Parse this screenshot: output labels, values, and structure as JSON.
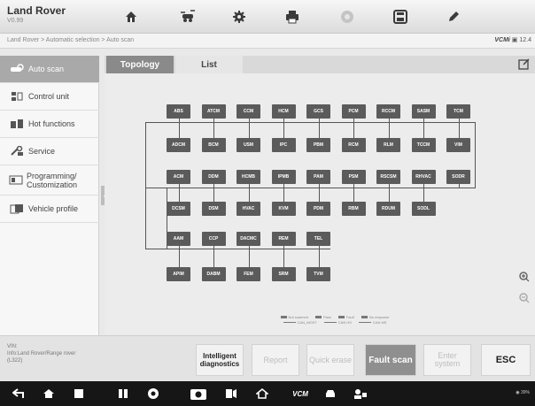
{
  "app": {
    "name": "Land Rover",
    "version": "V0.99"
  },
  "toolbar": {
    "items": [
      {
        "icon": "home-icon"
      },
      {
        "icon": "vehicle-swap-icon"
      },
      {
        "icon": "settings-icon"
      },
      {
        "icon": "print-icon"
      },
      {
        "icon": "help-icon"
      },
      {
        "icon": "save-icon"
      },
      {
        "icon": "edit-icon"
      }
    ]
  },
  "breadcrumb": "Land Rover > Automatic selection > Auto scan",
  "status": {
    "vcm_label": "VCMi",
    "vcm_value": "12.4"
  },
  "sidebar": {
    "items": [
      {
        "label": "Auto scan",
        "icon": "auto-scan-icon",
        "active": true
      },
      {
        "label": "Control unit",
        "icon": "control-unit-icon"
      },
      {
        "label": "Hot functions",
        "icon": "hot-functions-icon"
      },
      {
        "label": "Service",
        "icon": "service-icon"
      },
      {
        "label": "Programming/ Customization",
        "icon": "programming-icon"
      },
      {
        "label": "Vehicle profile",
        "icon": "vehicle-profile-icon"
      }
    ]
  },
  "tabs": [
    {
      "label": "Topology"
    },
    {
      "label": "List"
    }
  ],
  "ecu_rows": [
    [
      "ABS",
      "ATCM",
      "CCM",
      "HCM",
      "GCS",
      "PCM",
      "RCCM",
      "SASM",
      "TCM"
    ],
    [
      "ADCM",
      "BCM",
      "USM",
      "IPC",
      "PBM",
      "RCM",
      "RLM",
      "TCCM",
      "VIM"
    ],
    [
      "ACM",
      "DDM",
      "HCMB",
      "IPMB",
      "PAM",
      "PSM",
      "RSCSM",
      "RHVAC",
      "SODR"
    ],
    [
      "DCSM",
      "DSM",
      "HVAC",
      "KVM",
      "PDM",
      "RBM",
      "RDUM",
      "SODL"
    ],
    [
      "AAM",
      "CCP",
      "DACMC",
      "REM",
      "TEL"
    ],
    [
      "APIM",
      "DABM",
      "FEM",
      "SRM",
      "TVM"
    ]
  ],
  "legend": {
    "status": [
      "Not scanned",
      "Pass",
      "Fault",
      "No response"
    ],
    "buses": [
      "CAN_MOST",
      "CAN HS",
      "CAN MS"
    ]
  },
  "vin_info": {
    "vin_label": "VIN:",
    "vehicle": "Info:Land Rover/Range rover",
    "code": "(L322)"
  },
  "actions": [
    {
      "label": "Intelligent diagnostics",
      "style": "bold"
    },
    {
      "label": "Report",
      "style": "dim"
    },
    {
      "label": "Quick erase",
      "style": "dim"
    },
    {
      "label": "Fault scan",
      "style": "dark"
    },
    {
      "label": "Enter system",
      "style": "dim"
    },
    {
      "label": "ESC",
      "style": "bold"
    }
  ],
  "android_nav": [
    "back-icon",
    "home-icon",
    "recents-icon",
    "grid-icon",
    "browser-icon",
    "camera-icon",
    "media-icon",
    "house-icon",
    "vcm-icon",
    "car-icon",
    "user-group-icon"
  ],
  "sys_status": "39%"
}
